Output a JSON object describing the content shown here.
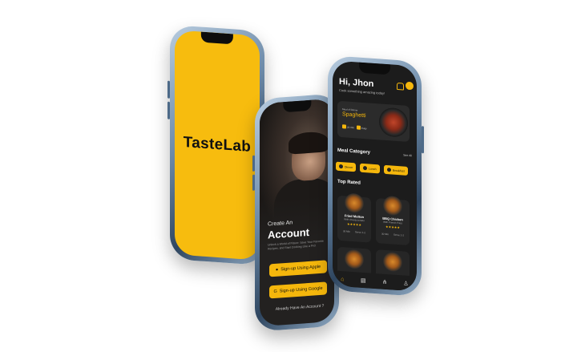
{
  "phone1": {
    "logo": "TasteLab"
  },
  "phone2": {
    "create_label": "Create An",
    "account_label": "Account",
    "description": "Unlock a World of Flavor: Save Your Favorite Recipes, and Start Cooking Like a Pro!",
    "apple_button": "Sign-up Using Apple",
    "google_button": "Sign-up Using Google",
    "login_link": "Already Have An Account ?"
  },
  "phone3": {
    "greeting": "Hi, Jhon",
    "subtitle": "Cook something amazing today!",
    "featured": {
      "label": "Meal of Dinner",
      "title": "Spaghetti",
      "time": "20 min",
      "difficulty": "Easy"
    },
    "meal_category_title": "Meal Category",
    "see_all": "See All",
    "categories": [
      "Dinner",
      "Lunch",
      "Breakfast"
    ],
    "top_rated_title": "Top Rated",
    "top_rated": [
      {
        "name": "Fried Mutton",
        "sub": "With cheesy potato",
        "stars": "★★★★★",
        "time": "30 Min",
        "serves": "Serve 1-2"
      },
      {
        "name": "BBQ Chicken",
        "sub": "With French Fries",
        "stars": "★★★★★",
        "time": "30 Min",
        "serves": "Serve 1-2"
      }
    ],
    "nav": [
      "⌂",
      "▤",
      "⋔",
      "♙"
    ]
  }
}
